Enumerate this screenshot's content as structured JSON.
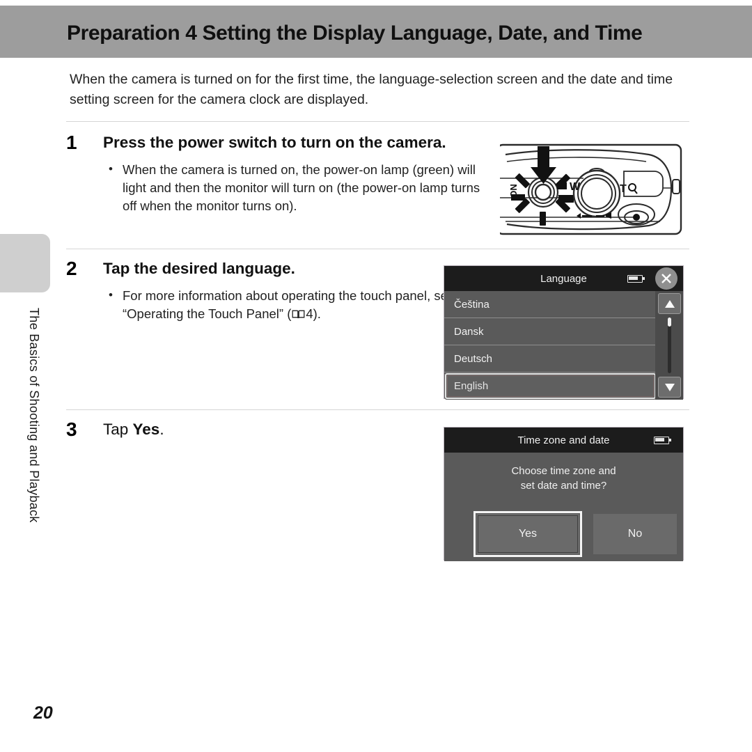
{
  "header": {
    "title": "Preparation 4 Setting the Display Language, Date, and Time"
  },
  "side_tab": {
    "chapter_label": "The Basics of Shooting and Playback"
  },
  "intro": {
    "paragraph": "When the camera is turned on for the first time, the language-selection screen and the date and time setting screen for the camera clock are displayed."
  },
  "steps": [
    {
      "number": "1",
      "heading": "Press the power switch to turn on the camera.",
      "bullets": [
        "When the camera is turned on, the power-on lamp (green) will light and then the monitor will turn on (the power-on lamp turns off when the monitor turns on)."
      ]
    },
    {
      "number": "2",
      "heading": "Tap the desired language.",
      "bullets": [
        "For more information about operating the touch panel, see “Operating the Touch Panel” ("
      ],
      "bullet_suffix": "4)."
    },
    {
      "number": "3",
      "heading_prefix": "Tap ",
      "heading_bold": "Yes",
      "heading_suffix": "."
    }
  ],
  "camera_illustration": {
    "labels": {
      "power_on": "ON",
      "zoom_wide": "W",
      "zoom_tele": "T"
    },
    "arrow": "down-arrow-pressing-power-button"
  },
  "language_screen": {
    "title": "Language",
    "battery_icon": "battery-icon",
    "close_icon": "close-icon",
    "items": [
      {
        "label": "Čeština",
        "selected": false
      },
      {
        "label": "Dansk",
        "selected": false
      },
      {
        "label": "Deutsch",
        "selected": false
      },
      {
        "label": "English",
        "selected": true
      }
    ],
    "scroll_up_icon": "triangle-up-icon",
    "scroll_down_icon": "triangle-down-icon"
  },
  "timezone_screen": {
    "title": "Time zone and date",
    "battery_icon": "battery-icon",
    "message_line1": "Choose time zone and",
    "message_line2": "set date and time?",
    "yes_label": "Yes",
    "no_label": "No"
  },
  "footer": {
    "page_number": "20"
  },
  "colors": {
    "header_band": "#9d9d9d",
    "side_tab": "#cfcfcf",
    "lcd_titlebar": "#1c1c1c",
    "lcd_body": "#5a5a5a",
    "rule": "#d5d5d5"
  }
}
